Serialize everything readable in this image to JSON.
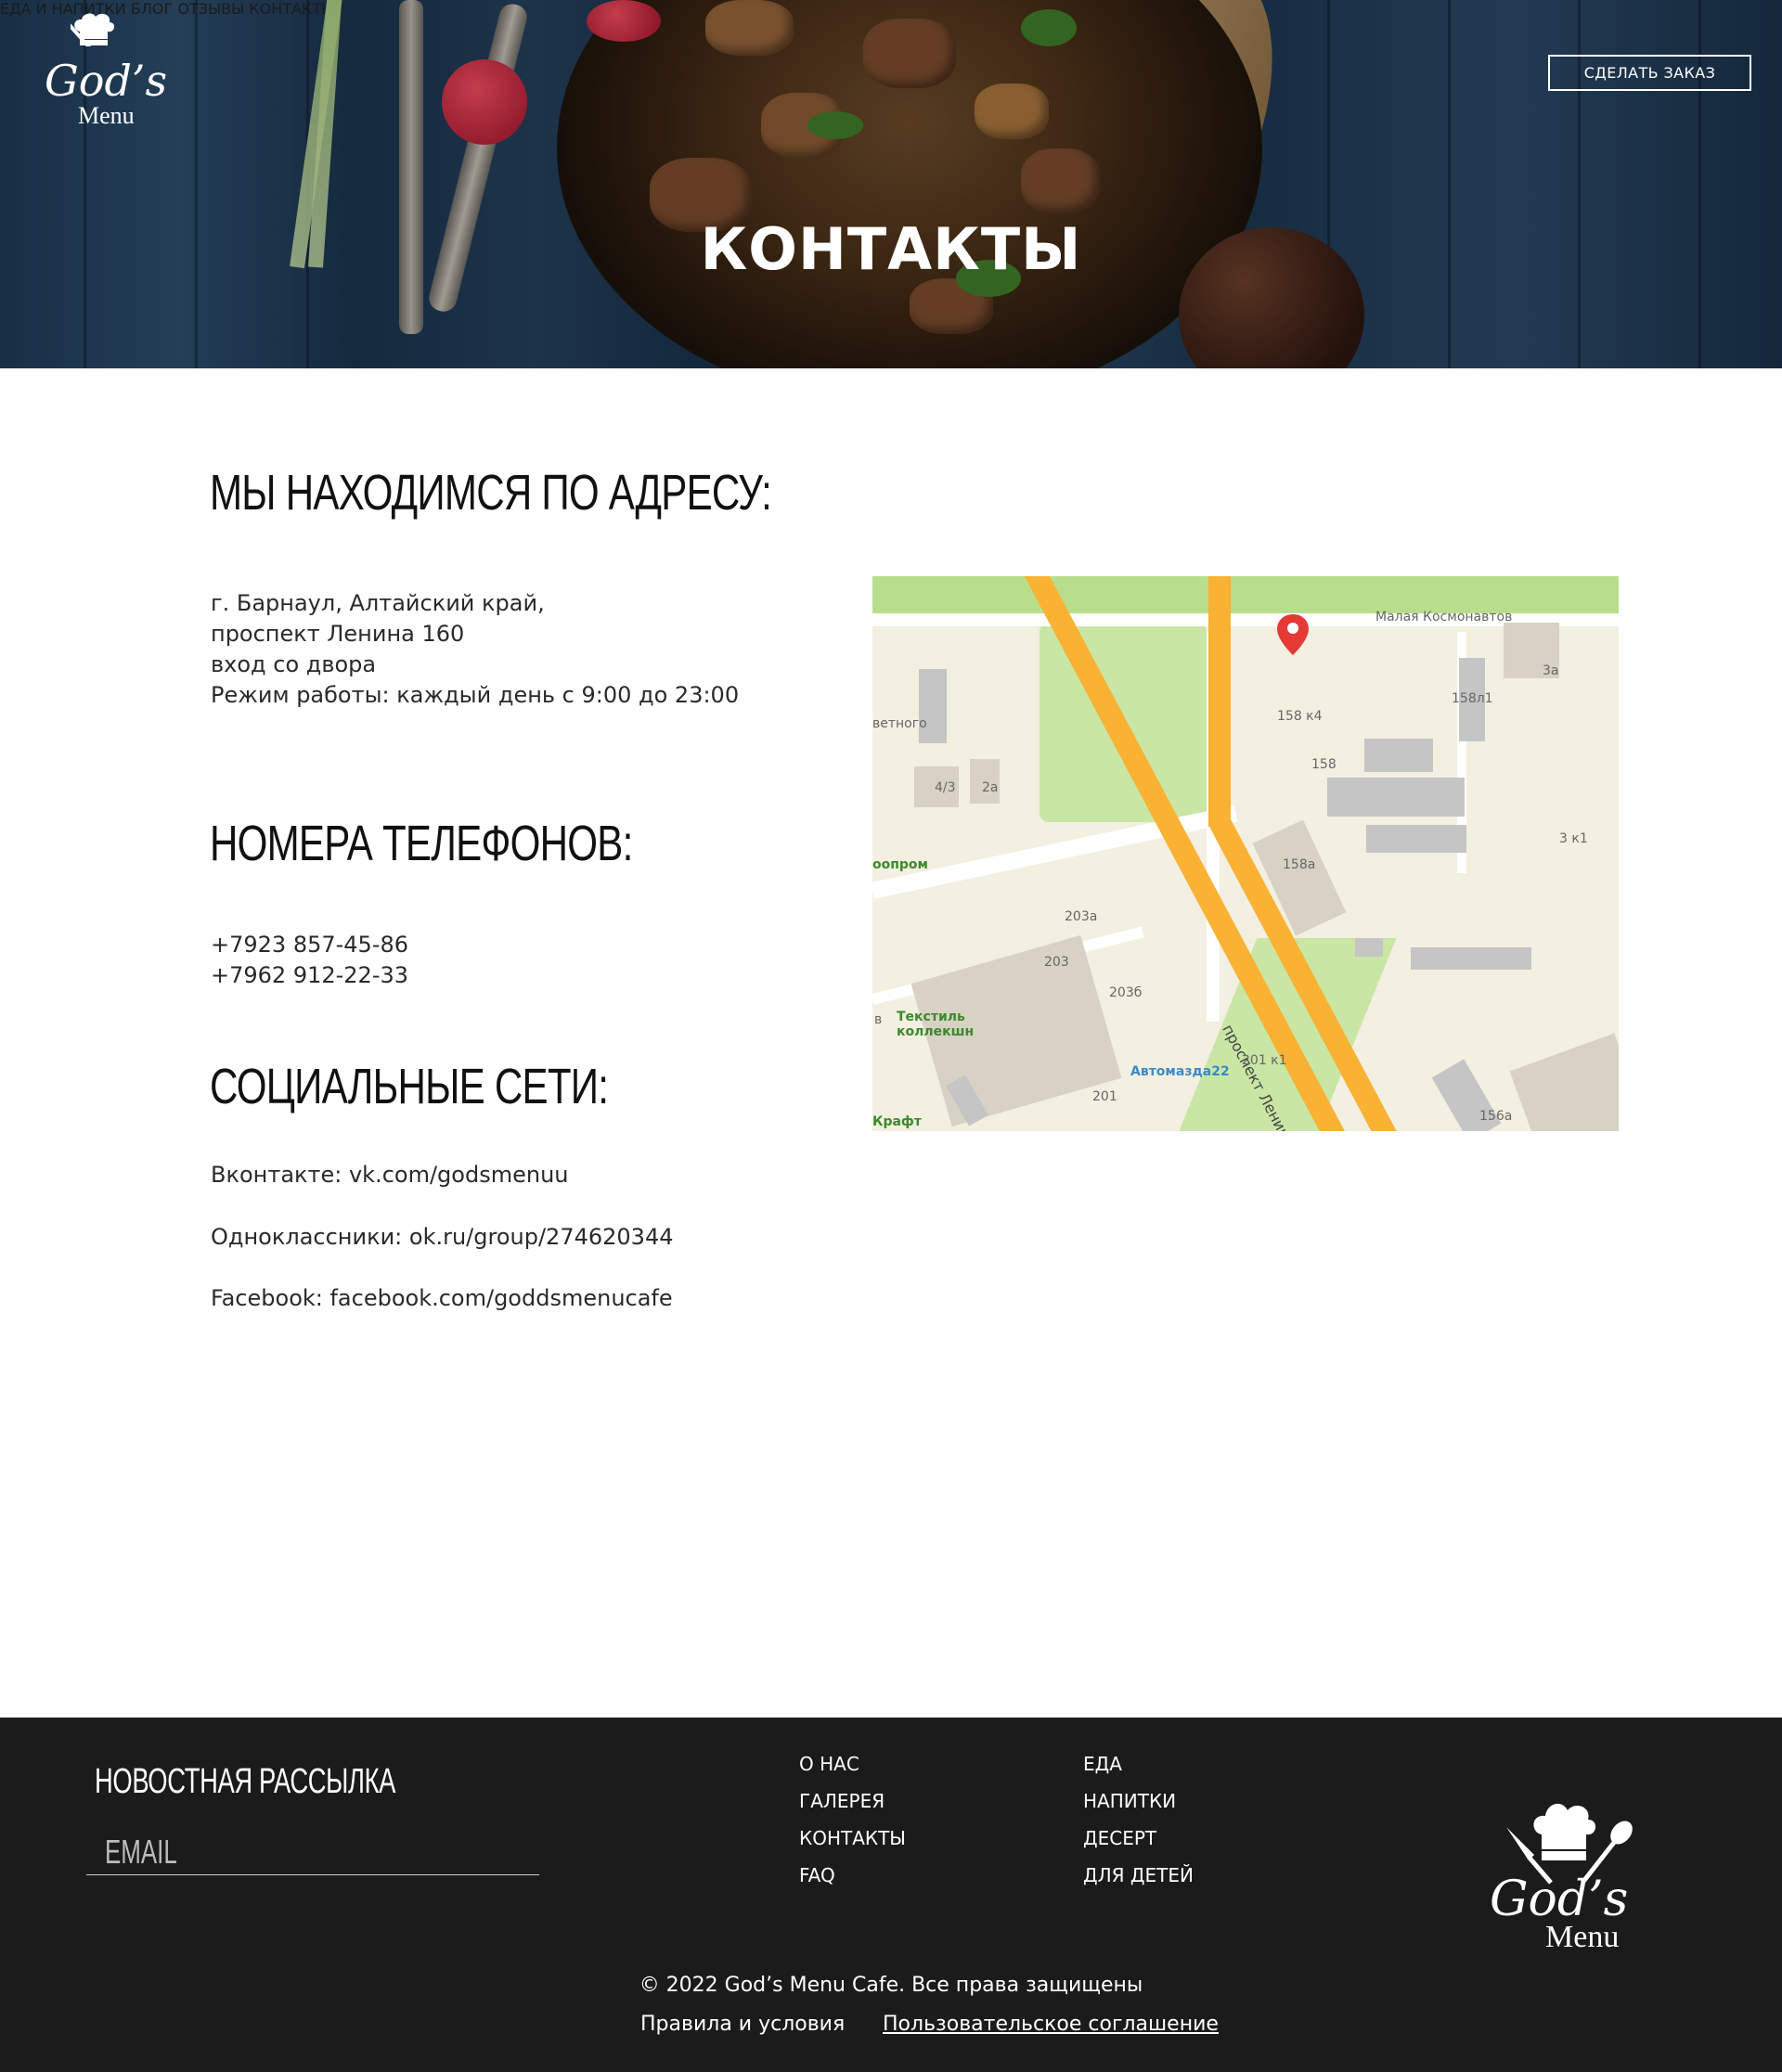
{
  "brand": {
    "logo_word": "Menu",
    "logo_script": "God’s"
  },
  "nav": {
    "items": [
      {
        "label": "ЕДА И НАПИТКИ"
      },
      {
        "label": "БЛОГ"
      },
      {
        "label": "ОТЗЫВЫ"
      },
      {
        "label": "КОНТАКТЫ"
      }
    ],
    "order_button": "СДЕЛАТЬ ЗАКАЗ"
  },
  "hero": {
    "title": "КОНТАКТЫ"
  },
  "address": {
    "heading": "МЫ НАХОДИМСЯ ПО АДРЕСУ:",
    "lines": [
      "г. Барнаул, Алтайский край,",
      "проспект Ленина 160",
      "вход со двора",
      "Режим работы: каждый день с 9:00 до 23:00"
    ]
  },
  "phones": {
    "heading": "НОМЕРА ТЕЛЕФОНОВ:",
    "numbers": [
      "+7923 857-45-86",
      "+7962 912-22-33"
    ]
  },
  "social": {
    "heading": "СОЦИАЛЬНЫЕ СЕТИ:",
    "items": [
      "Вконтакте: vk.com/godsmenuu",
      "Одноклассники: ok.ru/group/274620344",
      "Facebook: facebook.com/goddsmenucafe"
    ]
  },
  "map": {
    "street_top": "Малая Космонавтов",
    "street_main": "проспект Ленина",
    "labels": [
      "3а",
      "158л1",
      "158 к4",
      "158",
      "3 к1",
      "158а",
      "4/3",
      "2а",
      "203а",
      "203",
      "203б",
      "201 к1",
      "201",
      "156а",
      "ветного",
      "оопром",
      "в",
      "Крафт"
    ],
    "poi_green": "Текстиль коллекшн",
    "poi_blue": "Автомазда22"
  },
  "footer": {
    "newsletter_title": "НОВОСТНАЯ РАССЫЛКА",
    "email_placeholder": "EMAIL",
    "links_col1": [
      "О НАС",
      "ГАЛЕРЕЯ",
      "КОНТАКТЫ",
      "FAQ"
    ],
    "links_col2": [
      "ЕДА",
      "НАПИТКИ",
      "ДЕСЕРТ",
      "ДЛЯ ДЕТЕЙ"
    ],
    "copyright": "© 2022 God’s Menu Cafe. Все права защищены",
    "terms": "Правила и условия",
    "agreement": "Пользовательское соглашение"
  },
  "colors": {
    "footer_bg": "#1b1b1b",
    "map_road": "#f9b233",
    "map_park": "#c9e6a5",
    "pin": "#e53935"
  }
}
